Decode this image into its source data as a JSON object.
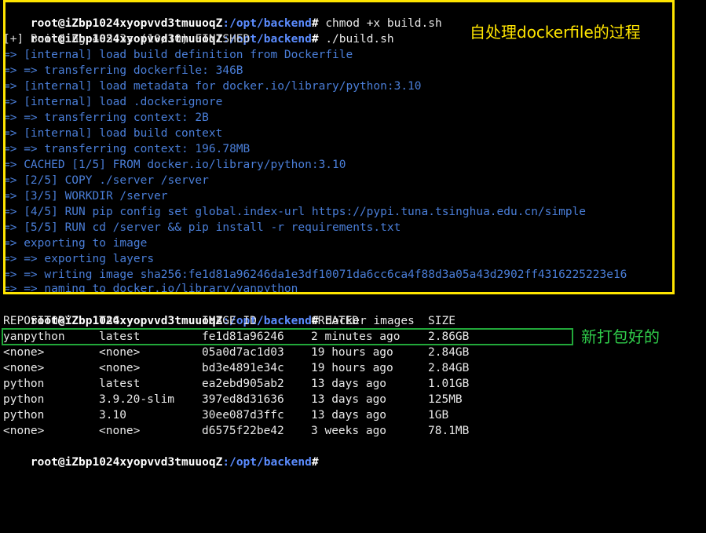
{
  "prompt": {
    "user_host": "root@iZbp1024xyopvvd3tmuuoqZ",
    "path": ":/opt/backend",
    "suffix": "#"
  },
  "commands": {
    "chmod": " chmod +x build.sh",
    "build": " ./build.sh",
    "images": " docker images"
  },
  "build_output": [
    "[+] Building 485.3s (10/10) FINISHED",
    "=> [internal] load build definition from Dockerfile",
    "=> => transferring dockerfile: 346B",
    "=> [internal] load metadata for docker.io/library/python:3.10",
    "=> [internal] load .dockerignore",
    "=> => transferring context: 2B",
    "=> [internal] load build context",
    "=> => transferring context: 196.78MB",
    "=> CACHED [1/5] FROM docker.io/library/python:3.10",
    "=> [2/5] COPY ./server /server",
    "=> [3/5] WORKDIR /server",
    "=> [4/5] RUN pip config set global.index-url https://pypi.tuna.tsinghua.edu.cn/simple",
    "=> [5/5] RUN cd /server && pip install -r requirements.txt",
    "=> exporting to image",
    "=> => exporting layers",
    "=> => writing image sha256:fe1d81a96246da1e3df10071da6cc6ca4f88d3a05a43d2902ff4316225223e16",
    "=> => naming to docker.io/library/yanpython"
  ],
  "images_table": {
    "headers": [
      "REPOSITORY",
      "TAG",
      "IMAGE ID",
      "CREATED",
      "SIZE"
    ],
    "rows": [
      [
        "yanpython",
        "latest",
        "fe1d81a96246",
        "2 minutes ago",
        "2.86GB"
      ],
      [
        "<none>",
        "<none>",
        "05a0d7ac1d03",
        "19 hours ago",
        "2.84GB"
      ],
      [
        "<none>",
        "<none>",
        "bd3e4891e34c",
        "19 hours ago",
        "2.84GB"
      ],
      [
        "python",
        "latest",
        "ea2ebd905ab2",
        "13 days ago",
        "1.01GB"
      ],
      [
        "python",
        "3.9.20-slim",
        "397ed8d31636",
        "13 days ago",
        "125MB"
      ],
      [
        "python",
        "3.10",
        "30ee087d3ffc",
        "13 days ago",
        "1GB"
      ],
      [
        "<none>",
        "<none>",
        "d6575f22be42",
        "3 weeks ago",
        "78.1MB"
      ]
    ]
  },
  "annotations": {
    "build_process": "自处理dockerfile的过程",
    "new_image": "新打包好的"
  },
  "colors": {
    "highlight_yellow": "#ffe500",
    "highlight_green": "#22a83a",
    "build_text_blue": "#4a7ed8"
  }
}
